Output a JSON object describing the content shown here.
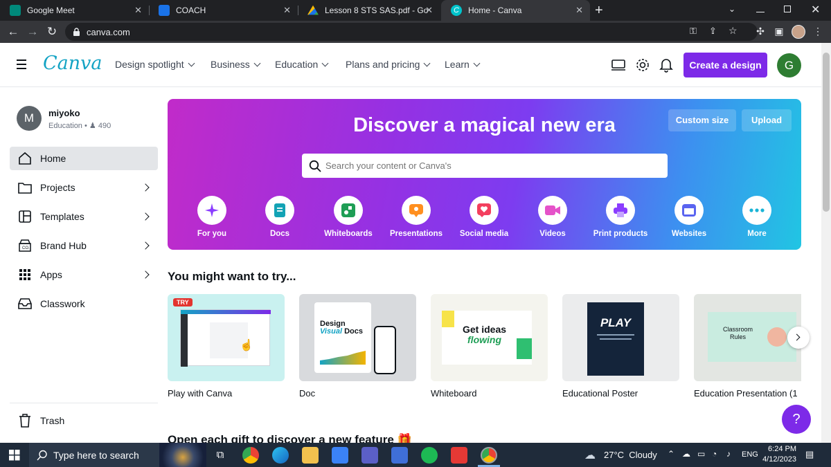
{
  "browser": {
    "tabs": [
      {
        "title": "Google Meet",
        "color": "#00897b"
      },
      {
        "title": "COACH",
        "color": "#1a73e8"
      },
      {
        "title": "Lesson 8 STS SAS.pdf - Google D",
        "color": "#fbbc04"
      },
      {
        "title": "Home - Canva",
        "color": "#00c4cc"
      }
    ],
    "url": "canva.com"
  },
  "header": {
    "logo": "Canva",
    "nav": [
      "Design spotlight",
      "Business",
      "Education",
      "Plans and pricing",
      "Learn"
    ],
    "create_button": "Create a design",
    "avatar_letter": "G",
    "accent_color": "#7d2ae8"
  },
  "profile": {
    "avatar_letter": "M",
    "name": "miyoko",
    "team": "Education",
    "members": "490"
  },
  "sidebar": {
    "items": [
      {
        "label": "Home",
        "icon": "home-icon",
        "arrow": false
      },
      {
        "label": "Projects",
        "icon": "folder-icon",
        "arrow": true
      },
      {
        "label": "Templates",
        "icon": "templates-icon",
        "arrow": true
      },
      {
        "label": "Brand Hub",
        "icon": "brand-hub-icon",
        "arrow": true
      },
      {
        "label": "Apps",
        "icon": "apps-grid-icon",
        "arrow": true
      },
      {
        "label": "Classwork",
        "icon": "inbox-icon",
        "arrow": false
      }
    ],
    "trash": "Trash"
  },
  "hero": {
    "title": "Discover a magical new era",
    "custom_size": "Custom size",
    "upload": "Upload",
    "search_placeholder": "Search your content or Canva's",
    "categories": [
      {
        "label": "For you",
        "icon": "sparkle-icon",
        "color": "#8b3dff"
      },
      {
        "label": "Docs",
        "icon": "doc-icon",
        "color": "#13a3b5"
      },
      {
        "label": "Whiteboards",
        "icon": "whiteboard-icon",
        "color": "#1e9e55"
      },
      {
        "label": "Presentations",
        "icon": "presentation-icon",
        "color": "#ff8f1f"
      },
      {
        "label": "Social media",
        "icon": "heart-icon",
        "color": "#f33f5e"
      },
      {
        "label": "Videos",
        "icon": "video-icon",
        "color": "#e552c9"
      },
      {
        "label": "Print products",
        "icon": "printer-icon",
        "color": "#8b3dff"
      },
      {
        "label": "Websites",
        "icon": "website-icon",
        "color": "#5a64f0"
      },
      {
        "label": "More",
        "icon": "more-icon",
        "color": "#1ab4d6"
      }
    ]
  },
  "section_title": "You might want to try...",
  "cards": [
    {
      "title": "Play with Canva",
      "badge": "TRY"
    },
    {
      "title": "Doc",
      "thumb_text": [
        "Design",
        "Visual",
        "Docs"
      ]
    },
    {
      "title": "Whiteboard",
      "thumb_text": [
        "Get ideas",
        "flowing"
      ]
    },
    {
      "title": "Educational Poster",
      "thumb_text": [
        "PLAY"
      ]
    },
    {
      "title": "Education Presentation (1",
      "thumb_text": [
        "Classroom",
        "Rules"
      ]
    }
  ],
  "next_section_title": "Open each gift to discover a new feature",
  "help": "?",
  "taskbar": {
    "search_placeholder": "Type here to search",
    "weather": "27°C  Cloudy",
    "language": "ENG",
    "time": "6:24 PM",
    "date": "4/12/2023"
  }
}
